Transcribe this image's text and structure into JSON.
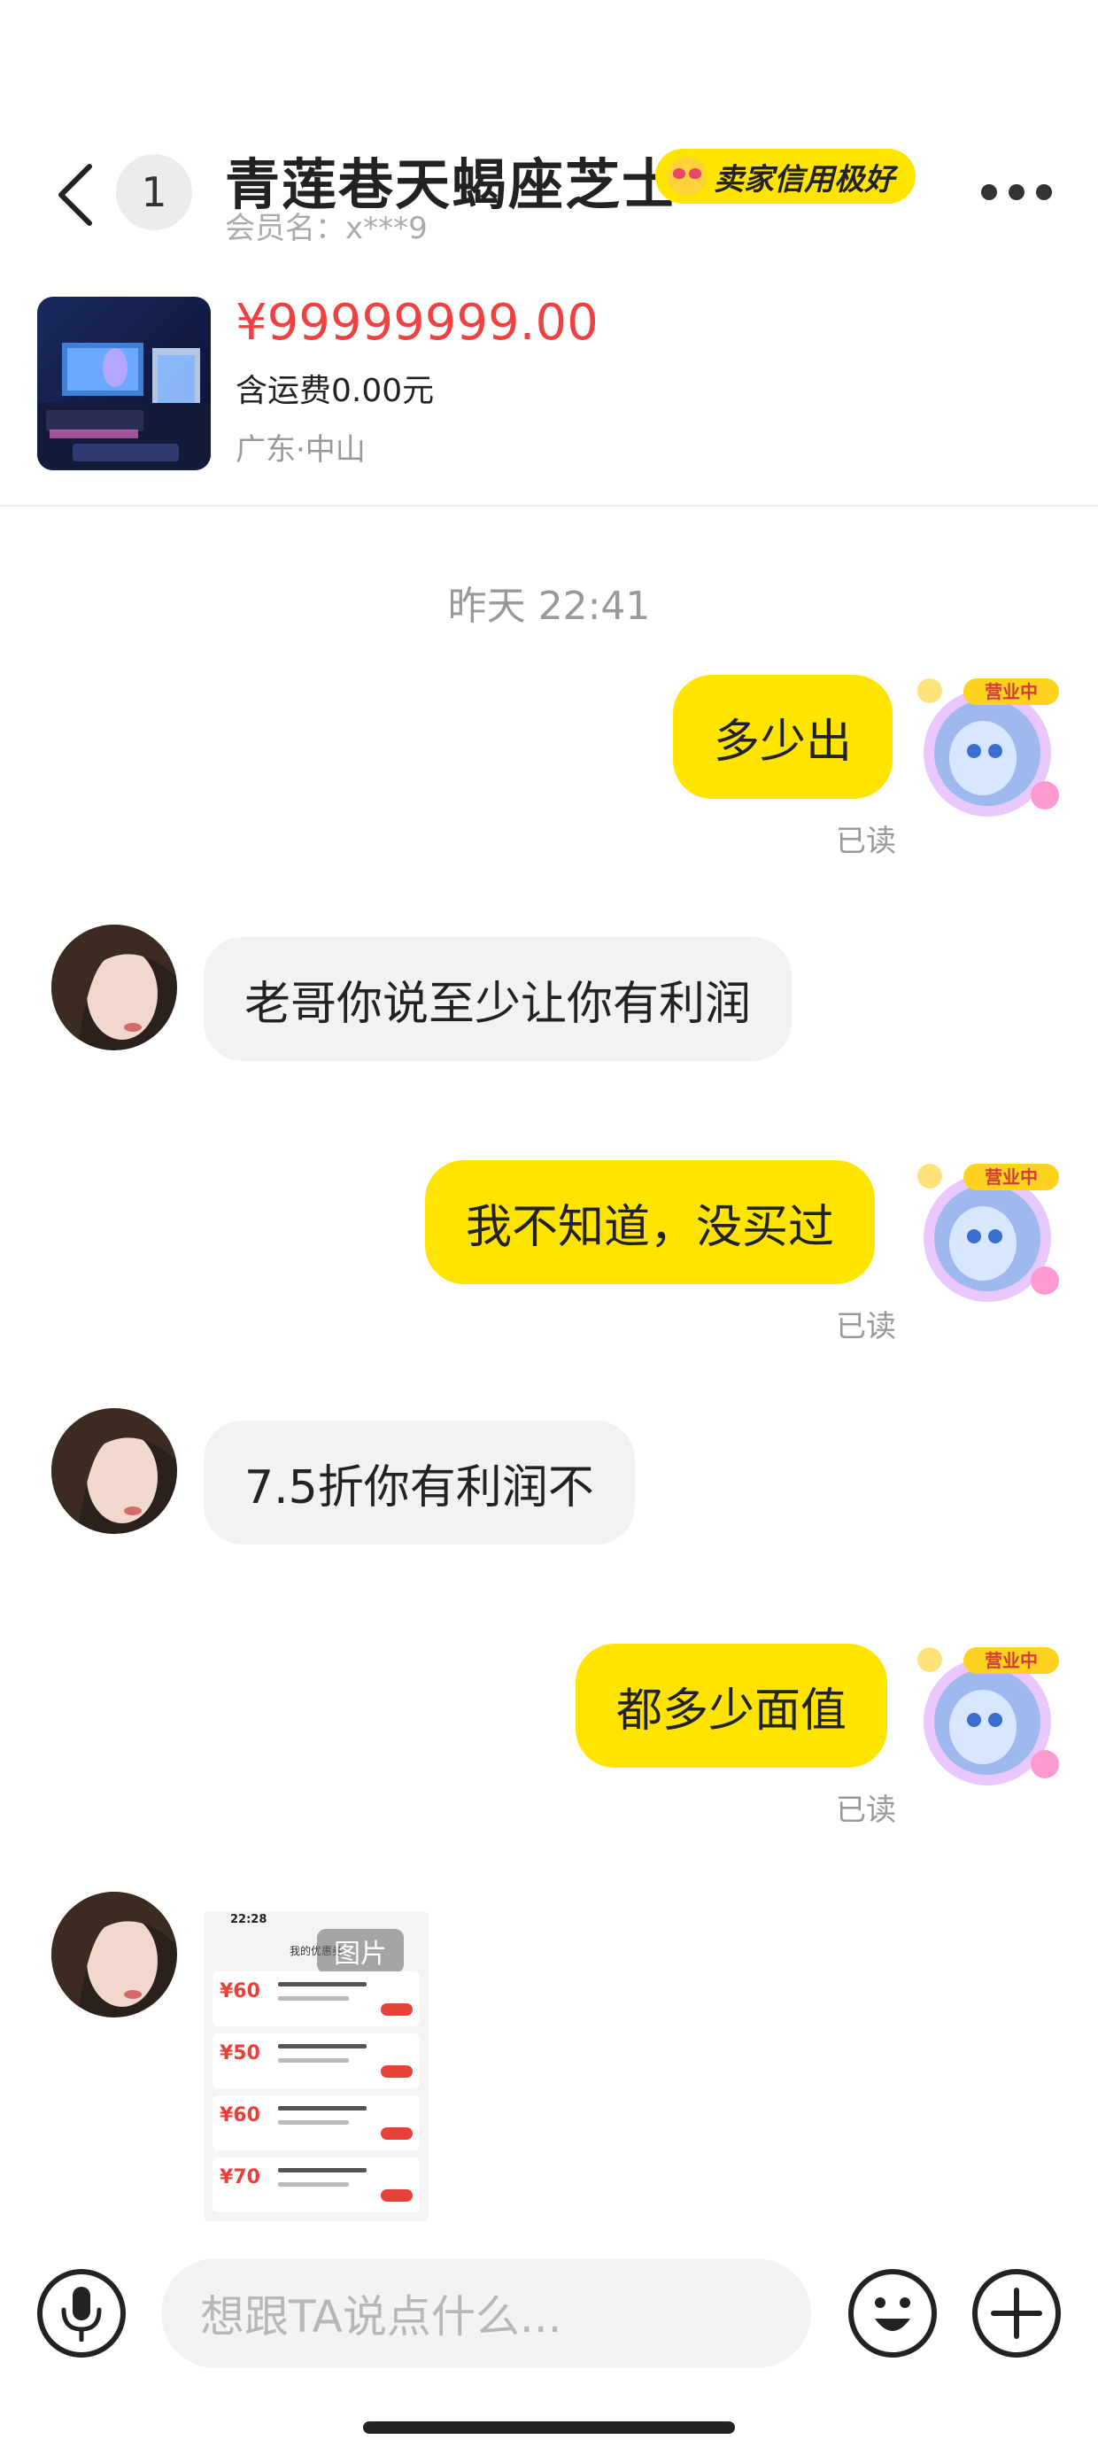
{
  "header": {
    "unread_count": "1",
    "seller_name": "青莲巷天蝎座芝士",
    "credit_badge": "卖家信用极好",
    "member_name": "会员名：x***9"
  },
  "product": {
    "price": "¥99999999.00",
    "shipping": "含运费0.00元",
    "location": "广东·中山"
  },
  "chat": {
    "timestamp": "昨天 22:41",
    "messages": [
      {
        "from": "me",
        "text": "多少出",
        "status": "已读"
      },
      {
        "from": "them",
        "text": "老哥你说至少让你有利润"
      },
      {
        "from": "me",
        "text": "我不知道，没买过",
        "status": "已读"
      },
      {
        "from": "them",
        "text": "7.5折你有利润不"
      },
      {
        "from": "me",
        "text": "都多少面值",
        "status": "已读"
      },
      {
        "from": "them",
        "type": "image",
        "image_tag": "图片"
      }
    ],
    "image_preview": {
      "status_time": "22:28",
      "title": "我的优惠券",
      "coupons": [
        "¥60",
        "¥50",
        "¥60",
        "¥70"
      ]
    }
  },
  "input": {
    "placeholder": "想跟TA说点什么..."
  },
  "colors": {
    "my_bubble": "#ffe400",
    "their_bubble": "#f2f2f3",
    "price": "#ef4141",
    "credit_badge": "#ffe500"
  },
  "icons": {
    "back": "chevron-left-icon",
    "more": "more-dots-icon",
    "voice": "microphone-icon",
    "emoji": "smiley-icon",
    "plus": "plus-icon"
  }
}
